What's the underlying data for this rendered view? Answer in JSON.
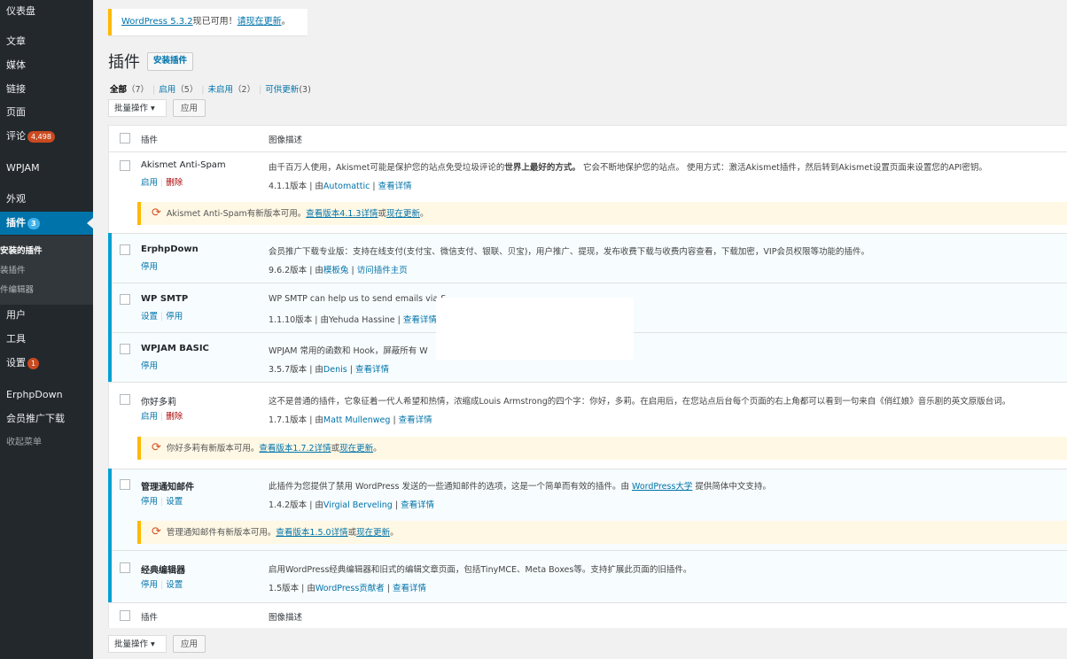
{
  "sidebar": {
    "items": [
      {
        "label": "仪表盘"
      },
      {
        "label": "文章"
      },
      {
        "label": "媒体"
      },
      {
        "label": "链接"
      },
      {
        "label": "页面"
      },
      {
        "label": "评论",
        "badge": "4,498"
      },
      {
        "label": "WPJAM"
      },
      {
        "label": "外观"
      },
      {
        "label": "插件",
        "badge": "3"
      },
      {
        "label": "用户"
      },
      {
        "label": "工具"
      },
      {
        "label": "设置",
        "badge": "1"
      },
      {
        "label": "ErphpDown"
      },
      {
        "label": "会员推广下载"
      },
      {
        "label": "收起菜单"
      }
    ],
    "submenu": [
      "安装的插件",
      "装插件",
      "件编辑器"
    ]
  },
  "notice": {
    "link": "WordPress 5.3.2",
    "text": "现已可用！",
    "action": "请现在更新",
    "end": "。"
  },
  "page": {
    "title": "插件",
    "add_new": "安装插件"
  },
  "filters": {
    "all": "全部",
    "all_count": "（7）",
    "active": "启用",
    "active_count": "（5）",
    "inactive": "未启用",
    "inactive_count": "（2）",
    "update": "可供更新",
    "update_count": "(3)"
  },
  "bulk": {
    "select": "批量操作",
    "apply": "应用"
  },
  "table": {
    "col_plugin": "插件",
    "col_desc": "图像描述"
  },
  "plugins": [
    {
      "name": "Akismet Anti-Spam",
      "actions": [
        "启用",
        "删除"
      ],
      "desc": "由千百万人使用，Akismet可能是保护您的站点免受垃圾评论的",
      "desc_bold": "世界上最好的方式。",
      "desc_rest": "它会不断地保护您的站点。 使用方式：激活Akismet插件，然后转到Akismet设置页面来设置您的API密钥。",
      "version": "4.1.1版本 | 由",
      "author": "Automattic",
      "details": "查看详情",
      "update": {
        "text": "Akismet Anti-Spam有新版本可用。",
        "view": "查看版本4.1.3详情",
        "or": "或",
        "now": "现在更新",
        "end": "。"
      }
    },
    {
      "name": "ErphpDown",
      "actions": [
        "停用"
      ],
      "desc": "会员推广下载专业版：支持在线支付(支付宝、微信支付、银联、贝宝)，用户推广、提现，发布收费下载与收费内容查看，下载加密，VIP会员权限等功能的插件。",
      "version": "9.6.2版本 | 由",
      "author": "模板兔",
      "details": "访问插件主页"
    },
    {
      "name": "WP SMTP",
      "actions": [
        "设置",
        "停用"
      ],
      "desc": "WP SMTP can help us to send emails via S",
      "version": "1.1.10版本 | 由Yehuda Hassine | ",
      "details": "查看详情"
    },
    {
      "name": "WPJAM BASIC",
      "actions": [
        "停用"
      ],
      "desc": "WPJAM 常用的函数和 Hook，屏蔽所有 W",
      "version": "3.5.7版本 | 由",
      "author": "Denis",
      "details": "查看详情"
    },
    {
      "name": "你好多莉",
      "actions": [
        "启用",
        "删除"
      ],
      "desc": "这不是普通的插件，它象征着一代人希望和热情，浓缩成Louis Armstrong的四个字：你好，多莉。在启用后，在您站点后台每个页面的右上角都可以看到一句来自《俏红娘》音乐剧的英文原版台词。",
      "version": "1.7.1版本 | 由",
      "author": "Matt Mullenweg",
      "details": "查看详情",
      "update": {
        "text": "你好多莉有新版本可用。",
        "view": "查看版本1.7.2详情",
        "or": "或",
        "now": "现在更新",
        "end": "。"
      }
    },
    {
      "name": "管理通知邮件",
      "actions": [
        "停用",
        "设置"
      ],
      "desc": "此插件为您提供了禁用 WordPress 发送的一些通知邮件的选项，这是一个简单而有效的插件。由 ",
      "desc_link": "WordPress大学",
      "desc_rest": " 提供简体中文支持。",
      "version": "1.4.2版本 | 由",
      "author": "Virgial Berveling",
      "details": "查看详情",
      "update": {
        "text": "管理通知邮件有新版本可用。",
        "view": "查看版本1.5.0详情",
        "or": "或",
        "now": "现在更新",
        "end": "。"
      }
    },
    {
      "name": "经典编辑器",
      "actions": [
        "停用",
        "设置"
      ],
      "desc": "启用WordPress经典编辑器和旧式的编辑文章页面，包括TinyMCE、Meta Boxes等。支持扩展此页面的旧插件。",
      "version": "1.5版本 | 由",
      "author": "WordPress贡献者",
      "details": "查看详情"
    }
  ],
  "colors": {
    "sidebar_bg": "#23282d",
    "active_menu": "#0073aa",
    "link": "#0073aa",
    "badge": "#ca4a1f",
    "active_edge": "#00a0d2",
    "warning": "#ffb900"
  }
}
